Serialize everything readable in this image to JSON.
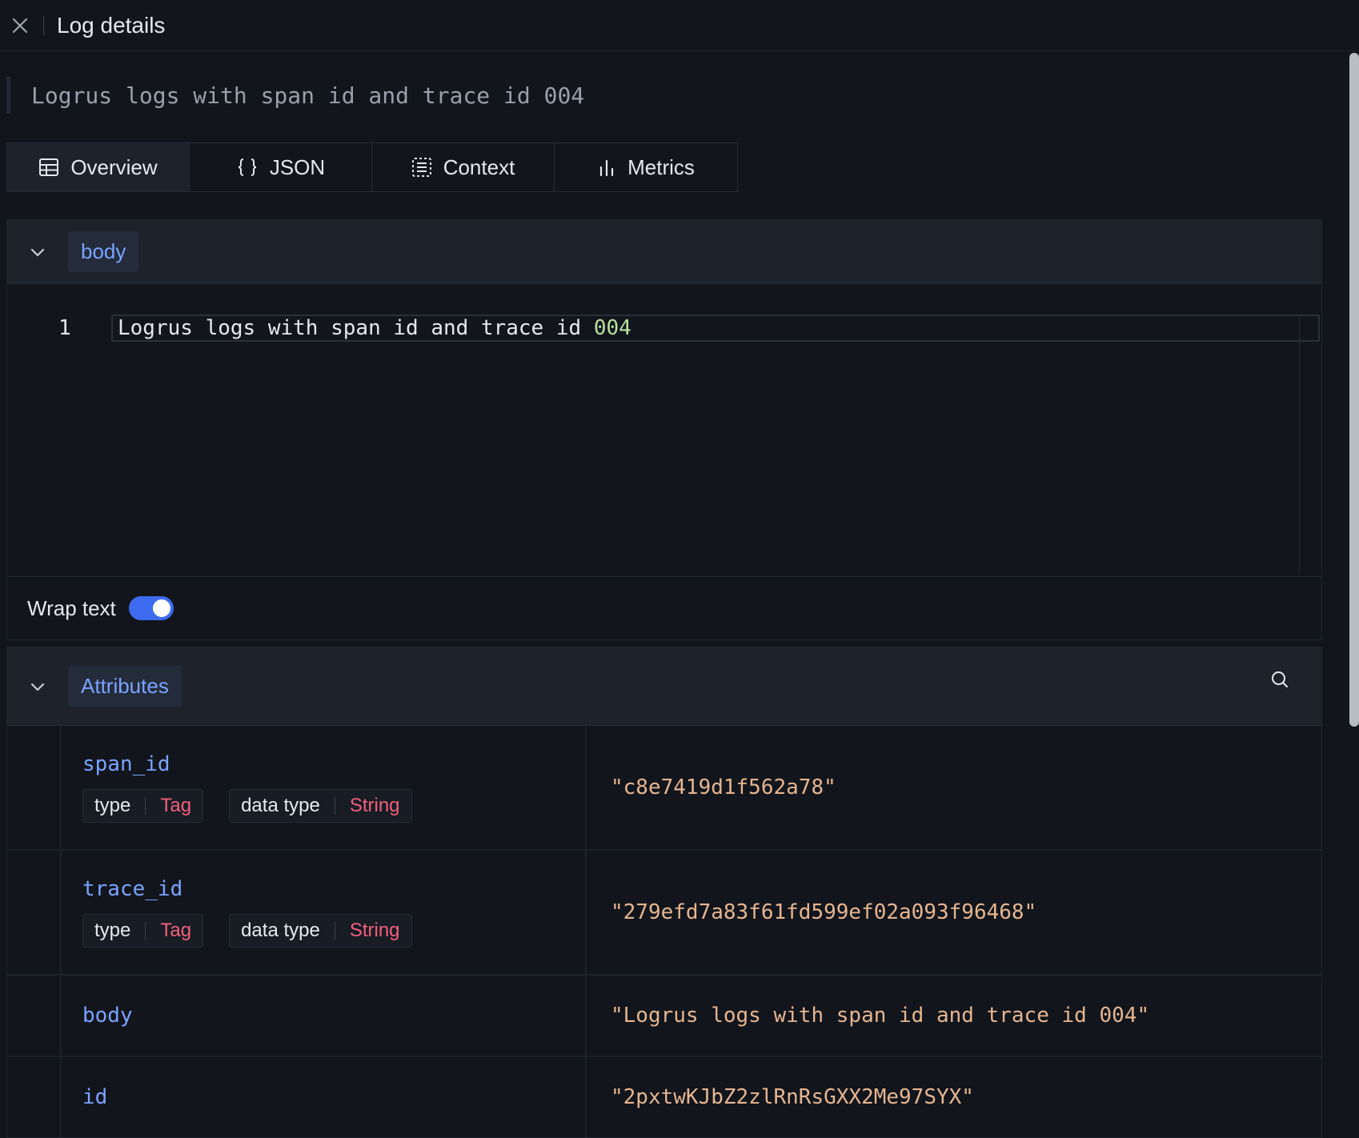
{
  "header": {
    "title": "Log details"
  },
  "summary": "Logrus logs with span id and trace id 004",
  "tabs": [
    {
      "label": "Overview",
      "icon": "table-icon",
      "active": true
    },
    {
      "label": "JSON",
      "icon": "braces-icon",
      "active": false
    },
    {
      "label": "Context",
      "icon": "context-icon",
      "active": false
    },
    {
      "label": "Metrics",
      "icon": "bar-chart-icon",
      "active": false
    }
  ],
  "body_section": {
    "label": "body",
    "line_number": "1",
    "code_text": "Logrus logs with span id and trace id ",
    "code_number": "004",
    "wrap_label": "Wrap text",
    "wrap_enabled": true
  },
  "attributes_section": {
    "label": "Attributes",
    "rows": [
      {
        "key": "span_id",
        "type_label": "type",
        "type_value": "Tag",
        "datatype_label": "data type",
        "datatype_value": "String",
        "value": "\"c8e7419d1f562a78\""
      },
      {
        "key": "trace_id",
        "type_label": "type",
        "type_value": "Tag",
        "datatype_label": "data type",
        "datatype_value": "String",
        "value": "\"279efd7a83f61fd599ef02a093f96468\""
      },
      {
        "key": "body",
        "value": "\"Logrus logs with span id and trace id 004\""
      },
      {
        "key": "id",
        "value": "\"2pxtwKJbZ2zlRnRsGXX2Me97SYX\""
      }
    ]
  },
  "colors": {
    "background": "#12151c",
    "accent_blue": "#7aa3ff",
    "toggle_on": "#3d6bf0",
    "tag_red": "#f0607a",
    "value_orange": "#e5b590"
  }
}
